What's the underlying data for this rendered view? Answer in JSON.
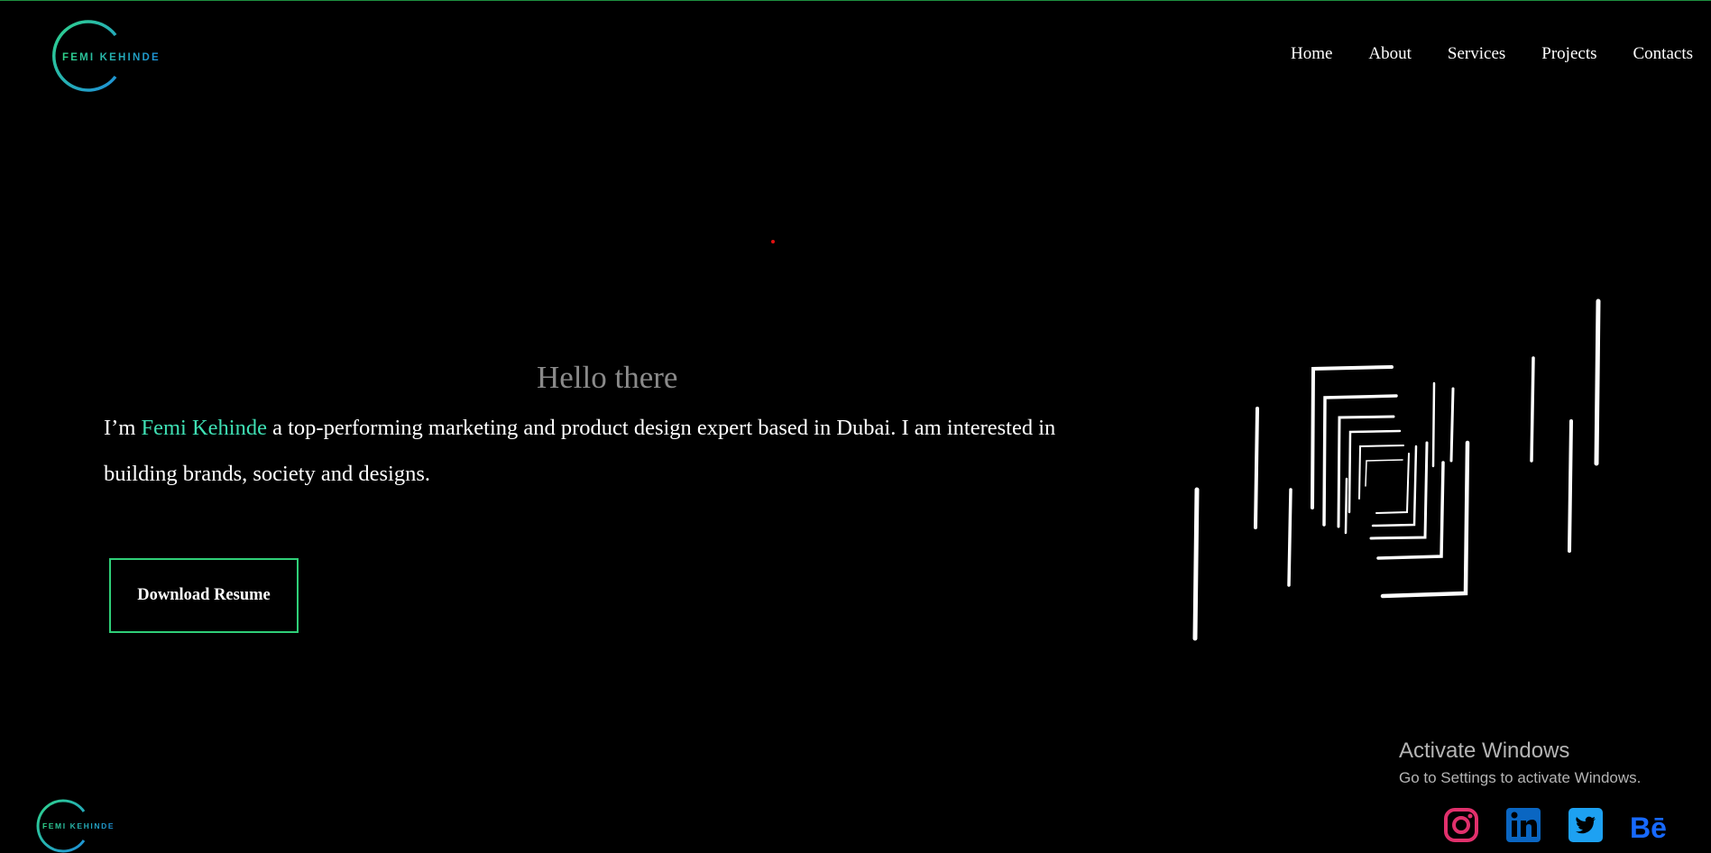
{
  "logo": {
    "text": "FEMI KEHINDE"
  },
  "nav": {
    "items": [
      "Home",
      "About",
      "Services",
      "Projects",
      "Contacts"
    ]
  },
  "hero": {
    "greeting": "Hello there",
    "intro_prefix": "I’m ",
    "intro_name": "Femi Kehinde",
    "intro_rest": " a top-performing marketing and product design expert based in Dubai. I am interested in building brands, society and designs.",
    "button_label": "Download Resume"
  },
  "watermark": {
    "title": "Activate Windows",
    "subtitle": "Go to Settings to activate Windows."
  },
  "footer": {
    "logo_text": "FEMI KEHINDE"
  },
  "social": [
    "instagram-icon",
    "linkedin-icon",
    "twitter-icon",
    "behance-icon"
  ],
  "colors": {
    "accent_teal": "#3fe0b4",
    "accent_green": "#2fcf78",
    "accent_blue": "#1e90d8",
    "instagram": "#e1306c",
    "linkedin": "#0a66c2",
    "twitter": "#1da1f2",
    "behance": "#1769ff"
  }
}
